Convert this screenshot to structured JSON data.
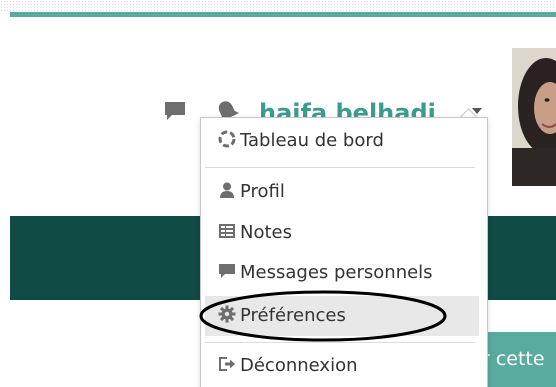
{
  "header": {
    "user_name": "haifa belhadj"
  },
  "icons": {
    "messages": "chat-bubble",
    "notifications": "bell",
    "menu_caret": "caret-down"
  },
  "user_menu": {
    "items": [
      {
        "label": "Tableau de bord",
        "icon": "dashboard"
      },
      {
        "label": "Profil",
        "icon": "user"
      },
      {
        "label": "Notes",
        "icon": "grid"
      },
      {
        "label": "Messages personnels",
        "icon": "chat-bubble"
      },
      {
        "label": "Préférences",
        "icon": "gear",
        "highlighted": true
      },
      {
        "label": "Déconnexion",
        "icon": "sign-out"
      }
    ]
  },
  "partial_button": {
    "label": "r cette"
  },
  "colors": {
    "accent": "#3b9b8f",
    "accent_bar": "#5aab9f",
    "dark_band": "#104b45",
    "highlight": "#e8e8e8"
  }
}
